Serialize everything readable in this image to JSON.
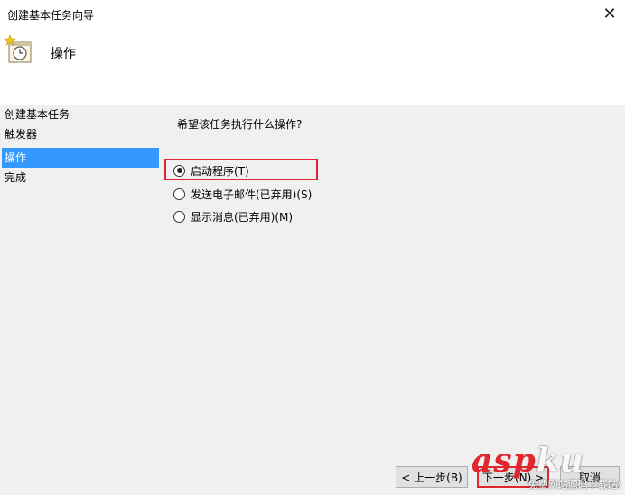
{
  "window": {
    "title": "创建基本任务向导",
    "close_label": "✕"
  },
  "header": {
    "title": "操作",
    "icon": "task-scheduler-clock-icon"
  },
  "sidebar": {
    "items": [
      {
        "label": "创建基本任务",
        "active": false
      },
      {
        "label": "触发器",
        "active": false
      },
      {
        "label": "操作",
        "active": true
      },
      {
        "label": "完成",
        "active": false
      }
    ]
  },
  "main": {
    "question": "希望该任务执行什么操作?",
    "options": [
      {
        "label": "启动程序(T)",
        "selected": true
      },
      {
        "label": "发送电子邮件(已弃用)(S)",
        "selected": false
      },
      {
        "label": "显示消息(已弃用)(M)",
        "selected": false
      }
    ]
  },
  "buttons": {
    "back": "< 上一步(B)",
    "next": "下一步(N) >",
    "cancel": "取消"
  },
  "watermark": {
    "main_asp": "asp",
    "main_ku": "ku",
    "sub": "免费网站源码下载站!"
  },
  "colors": {
    "highlight": "#e0262f",
    "selection": "#3399ff"
  }
}
